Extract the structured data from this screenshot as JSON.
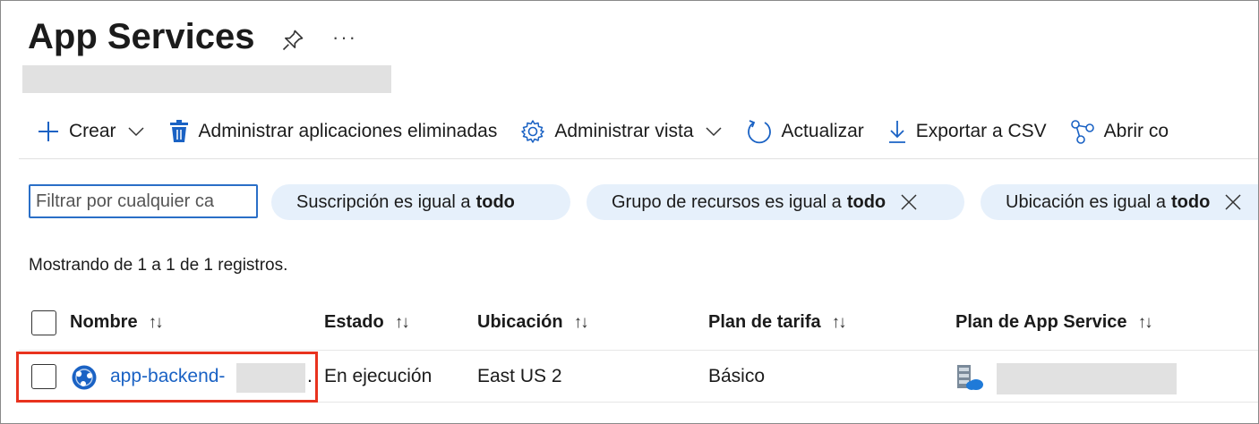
{
  "page": {
    "title": "App Services",
    "pin_icon": "pin-icon",
    "more_label": "···"
  },
  "toolbar": {
    "create_label": "Crear",
    "manage_deleted_label": "Administrar aplicaciones eliminadas",
    "manage_view_label": "Administrar vista",
    "refresh_label": "Actualizar",
    "export_label": "Exportar a CSV",
    "open_label": "Abrir co"
  },
  "filters": {
    "search_placeholder": "Filtrar por cualquier ca",
    "subscription": {
      "label": "Suscripción es igual a",
      "value": "todo"
    },
    "resource_group": {
      "label": "Grupo de recursos es igual a",
      "value": "todo"
    },
    "location": {
      "label": "Ubicación es igual a",
      "value": "todo"
    }
  },
  "records_text": "Mostrando de 1 a 1 de 1 registros.",
  "table": {
    "sort_glyph": "↑↓",
    "columns": [
      "Nombre",
      "Estado",
      "Ubicación",
      "Plan de tarifa",
      "Plan de App Service"
    ],
    "rows": [
      {
        "name": "app-backend-",
        "trailing": ".",
        "status": "En ejecución",
        "location": "East US 2",
        "tier": "Básico"
      }
    ]
  },
  "colors": {
    "accent": "#1a62c4",
    "pill_bg": "#e6f0fb",
    "highlight": "#e8321e",
    "redaction": "#e1e1e1"
  }
}
